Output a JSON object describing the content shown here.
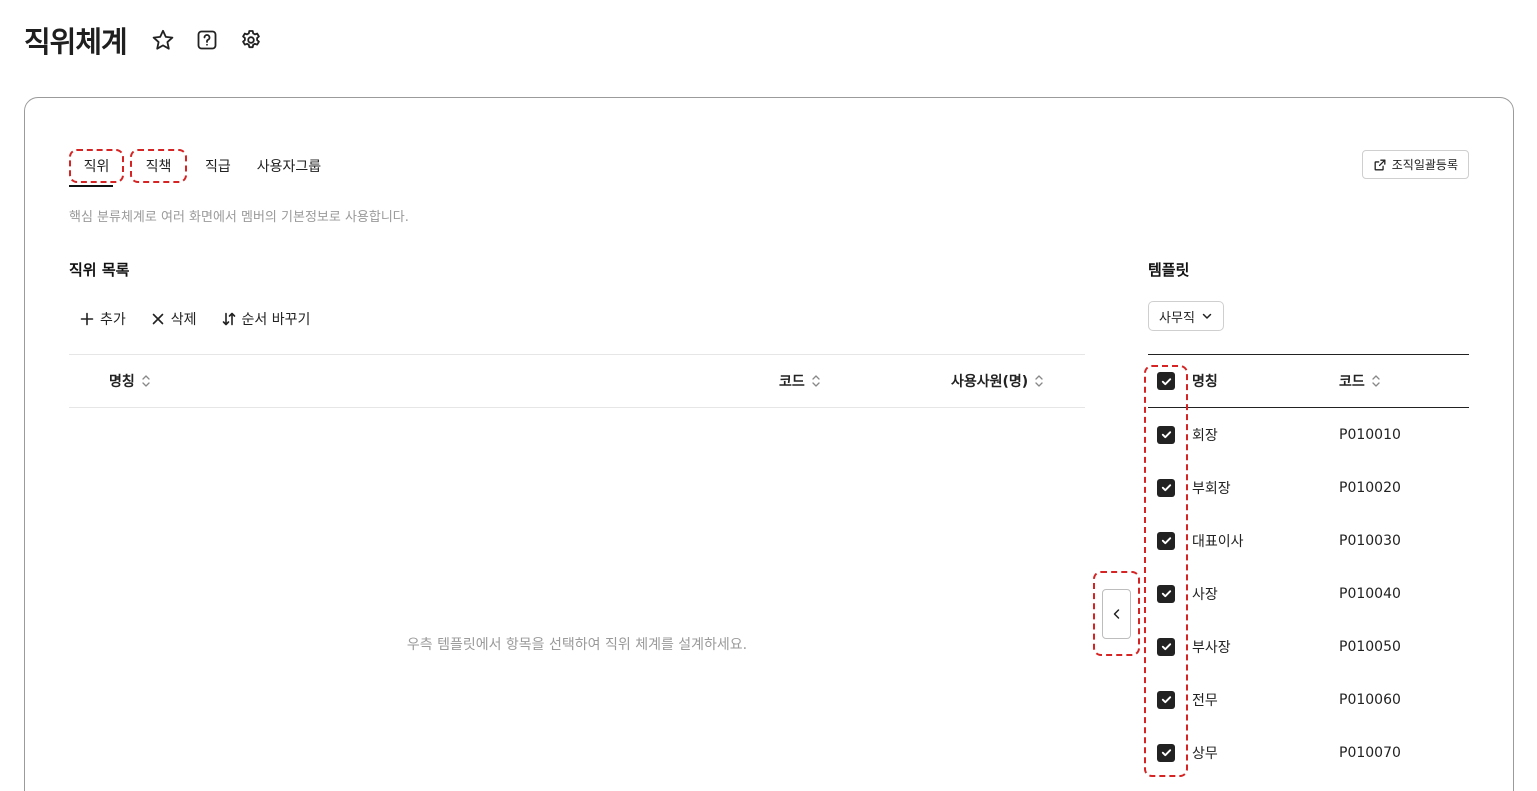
{
  "page": {
    "title": "직위체계"
  },
  "tabs": [
    {
      "label": "직위"
    },
    {
      "label": "직책"
    },
    {
      "label": "직급"
    },
    {
      "label": "사용자그룹"
    }
  ],
  "bulk_register": {
    "label": "조직일괄등록"
  },
  "description": "핵심 분류체계로 여러 화면에서 멤버의 기본정보로 사용합니다.",
  "list": {
    "title": "직위 목록",
    "toolbar": {
      "add": "추가",
      "delete": "삭제",
      "reorder": "순서 바꾸기"
    },
    "columns": {
      "name": "명칭",
      "code": "코드",
      "employees": "사용사원(명)"
    },
    "empty_message": "우측 템플릿에서 항목을 선택하여 직위 체계를 설계하세요."
  },
  "template": {
    "title": "템플릿",
    "selected": "사무직",
    "columns": {
      "name": "명칭",
      "code": "코드"
    },
    "rows": [
      {
        "name": "회장",
        "code": "P010010",
        "checked": true
      },
      {
        "name": "부회장",
        "code": "P010020",
        "checked": true
      },
      {
        "name": "대표이사",
        "code": "P010030",
        "checked": true
      },
      {
        "name": "사장",
        "code": "P010040",
        "checked": true
      },
      {
        "name": "부사장",
        "code": "P010050",
        "checked": true
      },
      {
        "name": "전무",
        "code": "P010060",
        "checked": true
      },
      {
        "name": "상무",
        "code": "P010070",
        "checked": true
      }
    ]
  },
  "colors": {
    "accent_dashed": "#d62424",
    "checkbox": "#222222"
  }
}
